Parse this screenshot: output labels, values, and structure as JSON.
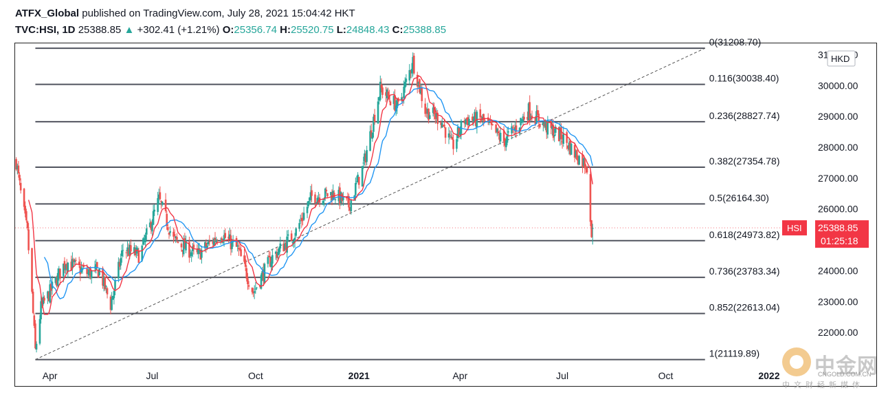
{
  "header": {
    "author": "ATFX_Global",
    "published": "published on TradingView.com, July 28, 2021 15:04:42 HKT",
    "symbol": "TVC:HSI, 1D",
    "last": "25388.85",
    "change": "+302.41 (+1.21%)",
    "o_label": "O:",
    "o": "25356.74",
    "h_label": "H:",
    "h": "25520.75",
    "l_label": "L:",
    "l": "24848.43",
    "c_label": "C:",
    "c": "25388.85"
  },
  "chart_data": {
    "type": "candlestick",
    "currency": "HKD",
    "y_range": [
      21000,
      31300
    ],
    "x_range": [
      "2020-03-01",
      "2022-01-20"
    ],
    "x_ticks": [
      {
        "label": "Apr",
        "date": "2020-04-01"
      },
      {
        "label": "Jul",
        "date": "2020-07-01"
      },
      {
        "label": "Oct",
        "date": "2020-10-01"
      },
      {
        "label": "2021",
        "date": "2021-01-01",
        "bold": true
      },
      {
        "label": "Apr",
        "date": "2021-04-01"
      },
      {
        "label": "Jul",
        "date": "2021-07-01"
      },
      {
        "label": "Oct",
        "date": "2021-10-01"
      },
      {
        "label": "2022",
        "date": "2022-01-01",
        "bold": true
      }
    ],
    "y_ticks": [
      {
        "label": "31000.00",
        "value": 31000
      },
      {
        "label": "30000.00",
        "value": 30000
      },
      {
        "label": "29000.00",
        "value": 29000
      },
      {
        "label": "28000.00",
        "value": 28000
      },
      {
        "label": "27000.00",
        "value": 27000
      },
      {
        "label": "26000.00",
        "value": 26000
      },
      {
        "label": "24000.00",
        "value": 24000
      },
      {
        "label": "23000.00",
        "value": 23000
      },
      {
        "label": "22000.00",
        "value": 22000
      }
    ],
    "fib_levels": [
      {
        "ratio": "0",
        "value": 31208.7,
        "label": "0(31208.70)"
      },
      {
        "ratio": "0.116",
        "value": 30038.4,
        "label": "0.116(30038.40)"
      },
      {
        "ratio": "0.236",
        "value": 28827.74,
        "label": "0.236(28827.74)"
      },
      {
        "ratio": "0.382",
        "value": 27354.78,
        "label": "0.382(27354.78)"
      },
      {
        "ratio": "0.5",
        "value": 26164.3,
        "label": "0.5(26164.30)"
      },
      {
        "ratio": "0.618",
        "value": 24973.82,
        "label": "0.618(24973.82)"
      },
      {
        "ratio": "0.736",
        "value": 23783.34,
        "label": "0.736(23783.34)"
      },
      {
        "ratio": "0.852",
        "value": 22613.04,
        "label": "0.852(22613.04)"
      },
      {
        "ratio": "1",
        "value": 21119.89,
        "label": "1(21119.89)"
      }
    ],
    "fib_start_date": "2020-03-19",
    "fib_end_date": "2021-11-05",
    "trend_line": {
      "from": {
        "date": "2020-03-19",
        "value": 21119.89
      },
      "to": {
        "date": "2021-11-05",
        "value": 31208.7
      }
    },
    "price_anchors": [
      [
        "2020-03-01",
        27800
      ],
      [
        "2020-03-06",
        26500
      ],
      [
        "2020-03-12",
        25200
      ],
      [
        "2020-03-16",
        23200
      ],
      [
        "2020-03-19",
        21400
      ],
      [
        "2020-03-24",
        22800
      ],
      [
        "2020-04-01",
        23300
      ],
      [
        "2020-04-15",
        24300
      ],
      [
        "2020-05-05",
        23900
      ],
      [
        "2020-05-15",
        24000
      ],
      [
        "2020-05-25",
        22900
      ],
      [
        "2020-06-05",
        24700
      ],
      [
        "2020-06-20",
        24500
      ],
      [
        "2020-07-07",
        26300
      ],
      [
        "2020-07-20",
        25000
      ],
      [
        "2020-08-10",
        24500
      ],
      [
        "2020-08-31",
        25200
      ],
      [
        "2020-09-15",
        24700
      ],
      [
        "2020-09-29",
        23300
      ],
      [
        "2020-10-15",
        24400
      ],
      [
        "2020-11-05",
        25200
      ],
      [
        "2020-11-20",
        26400
      ],
      [
        "2020-12-10",
        26500
      ],
      [
        "2020-12-23",
        26100
      ],
      [
        "2021-01-05",
        27400
      ],
      [
        "2021-01-20",
        29900
      ],
      [
        "2021-02-05",
        29300
      ],
      [
        "2021-02-18",
        30800
      ],
      [
        "2021-03-01",
        29200
      ],
      [
        "2021-03-15",
        28900
      ],
      [
        "2021-03-25",
        28000
      ],
      [
        "2021-04-05",
        28900
      ],
      [
        "2021-04-20",
        28900
      ],
      [
        "2021-05-10",
        28200
      ],
      [
        "2021-05-20",
        28600
      ],
      [
        "2021-06-01",
        29200
      ],
      [
        "2021-06-15",
        28700
      ],
      [
        "2021-07-02",
        28300
      ],
      [
        "2021-07-12",
        27800
      ],
      [
        "2021-07-23",
        27400
      ],
      [
        "2021-07-27",
        25100
      ],
      [
        "2021-07-28",
        25388.85
      ]
    ],
    "series": [
      {
        "name": "MA fast",
        "color": "#f23645"
      },
      {
        "name": "MA slow",
        "color": "#2196f3"
      }
    ],
    "last_price": {
      "label": "HSI",
      "value": "25388.85",
      "countdown": "01:25:18",
      "color": "#f23645"
    }
  },
  "watermark": {
    "brand": "中金网",
    "site": "CNGOLD.COM.CN",
    "tagline": "中文财经新媒体"
  },
  "colors": {
    "up": "#26a69a",
    "down": "#ef5350",
    "fib": "#787b86",
    "text": "#131722"
  }
}
